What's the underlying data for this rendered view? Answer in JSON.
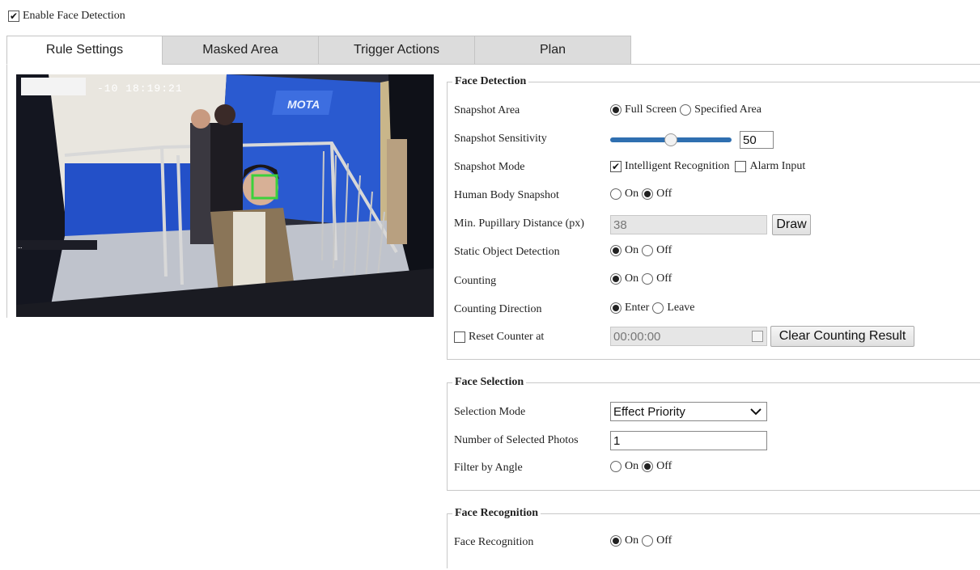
{
  "enable": {
    "label": "Enable Face Detection",
    "checked": true
  },
  "tabs": [
    {
      "label": "Rule Settings",
      "active": true
    },
    {
      "label": "Masked Area",
      "active": false
    },
    {
      "label": "Trigger Actions",
      "active": false
    },
    {
      "label": "Plan",
      "active": false
    }
  ],
  "video": {
    "osd_time": "-10 18:19:21"
  },
  "face_detection": {
    "legend": "Face Detection",
    "snapshot_area": {
      "label": "Snapshot Area",
      "opt1": "Full Screen",
      "opt2": "Specified Area",
      "selected": 1
    },
    "sensitivity": {
      "label": "Snapshot Sensitivity",
      "value": "50",
      "fraction": 0.5
    },
    "snapshot_mode": {
      "label": "Snapshot Mode",
      "opt1": "Intelligent Recognition",
      "opt1_checked": true,
      "opt2": "Alarm Input",
      "opt2_checked": false
    },
    "human_body": {
      "label": "Human Body Snapshot",
      "on": "On",
      "off": "Off",
      "selected": 2
    },
    "pupillary": {
      "label": "Min. Pupillary Distance (px)",
      "value": "38",
      "button": "Draw"
    },
    "static_obj": {
      "label": "Static Object Detection",
      "on": "On",
      "off": "Off",
      "selected": 1
    },
    "counting": {
      "label": "Counting",
      "on": "On",
      "off": "Off",
      "selected": 1
    },
    "direction": {
      "label": "Counting Direction",
      "opt1": "Enter",
      "opt2": "Leave",
      "selected": 1
    },
    "reset": {
      "label": "Reset Counter at",
      "checked": false,
      "time": "00:00:00",
      "button": "Clear Counting Result"
    }
  },
  "face_selection": {
    "legend": "Face Selection",
    "mode": {
      "label": "Selection Mode",
      "value": "Effect Priority"
    },
    "photos": {
      "label": "Number of Selected Photos",
      "value": "1"
    },
    "angle": {
      "label": "Filter by Angle",
      "on": "On",
      "off": "Off",
      "selected": 2
    }
  },
  "face_recognition": {
    "legend": "Face Recognition",
    "recognition": {
      "label": "Face Recognition",
      "on": "On",
      "off": "Off",
      "selected": 1
    }
  },
  "colors": {
    "slider": "#2f6fb0",
    "face_box": "#3cd13c"
  }
}
